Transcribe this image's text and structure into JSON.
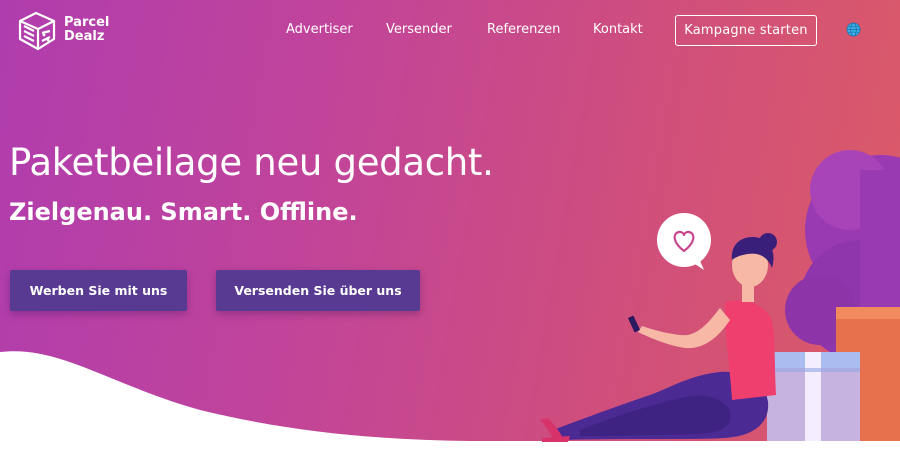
{
  "brand": {
    "name_line1": "Parcel",
    "name_line2": "Dealz",
    "logo_icon": "parcel-box-icon"
  },
  "nav": {
    "items": [
      {
        "label": "Advertiser"
      },
      {
        "label": "Versender"
      },
      {
        "label": "Referenzen"
      },
      {
        "label": "Kontakt"
      }
    ],
    "cta_label": "Kampagne starten",
    "language_icon": "globe-icon"
  },
  "hero": {
    "title": "Paketbeilage neu gedacht.",
    "subtitle": "Zielgenau. Smart. Offline.",
    "buttons": [
      {
        "label": "Werben Sie mit uns"
      },
      {
        "label": "Versenden Sie über uns"
      }
    ],
    "illustration": "woman-with-phone-and-parcels",
    "speech_bubble_icon": "heart-icon"
  },
  "colors": {
    "gradient_start": "#b03dae",
    "gradient_end": "#dc5b66",
    "button_bg": "#583a92",
    "text": "#ffffff"
  }
}
